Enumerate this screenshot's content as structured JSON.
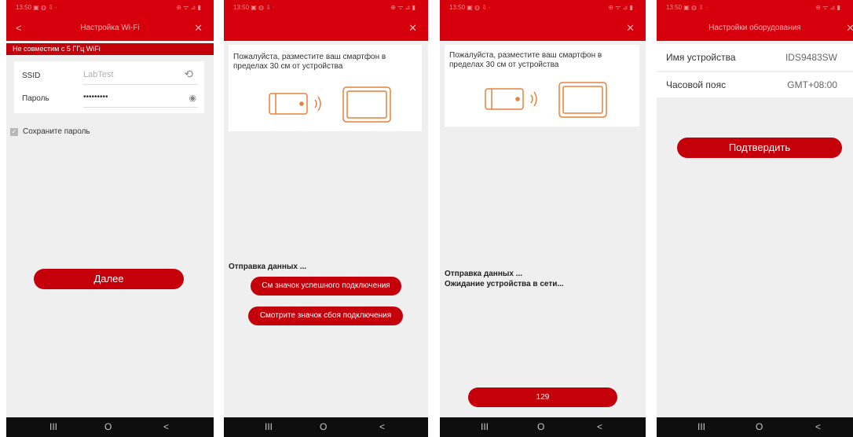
{
  "status_bar": {
    "time": "13:50 ▣ ◍ ⇩ ·",
    "system": "⊕ ᯤ ⊿ ▮"
  },
  "nav": {
    "recent": "III",
    "home": "O",
    "back": "<"
  },
  "screen1": {
    "title": "Настройка Wi-Fi",
    "warning": "Не совместим с 5 ГГц WiFi",
    "ssid_label": "SSID",
    "ssid_value": "LabTest",
    "password_label": "Пароль",
    "password_value": "•••••••••",
    "remember_label": "Сохраните пароль",
    "next_button": "Далее"
  },
  "screen2": {
    "instruction": "Пожалуйста, разместите ваш смартфон в пределах 30 см от устройства",
    "status": "Отправка данных ...",
    "success_button": "См значок успешного подключения",
    "failure_button": "Смотрите значок сбоя подключения"
  },
  "screen3": {
    "instruction": "Пожалуйста, разместите ваш смартфон в пределах 30 см от устройства",
    "status_line1": "Отправка данных ...",
    "status_line2": "Ожидание устройства в сети...",
    "countdown": "129"
  },
  "screen4": {
    "title": "Настройки оборудования",
    "device_name_label": "Имя устройства",
    "device_name_value": "IDS9483SW",
    "timezone_label": "Часовой пояс",
    "timezone_value": "GMT+08:00",
    "confirm_button": "Подтвердить"
  },
  "colors": {
    "brand_red": "#d6000c",
    "button_red": "#c4000b",
    "icon_orange": "#e8803a"
  }
}
